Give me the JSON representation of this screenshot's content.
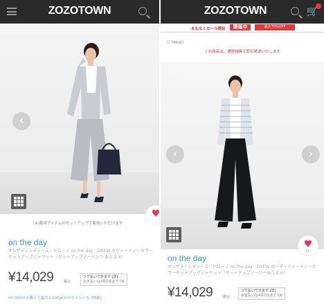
{
  "left": {
    "logo": "ZOZOTOWN",
    "caption": "[※]着用アイテムのセットアップで着用いただけます",
    "brand": "on the day",
    "product_name": "オンザディレディース：ドローノ on the day：DREW きツィードノーカラーセットアップジャケット（セットアップアーバンツ おりまメ）",
    "price": "¥14,029",
    "tax": "税込",
    "stock_line1": "ツケ払いできます [詳]",
    "stock_line2": "お支払いは4月1日まで OK",
    "promo": "¥5,000以上購入で最大1,000pt分のポイントも [詳細]"
  },
  "right": {
    "logo": "ZOZOTOWN",
    "sale_text": "まもなくセール開始",
    "sale_badge": "開催中",
    "sale_sub": "最大70%OFF",
    "breadcrumb": "三 TAKAO",
    "notice": "この商品は、通常価格で即日発送いたします",
    "brand": "on the day",
    "product_name": "オンザディレディース：ドローノ on the day：DREW ボーダーツィードノーカラーセットアップジャケット（セットアップノースーおりまメ）",
    "price": "¥14,029",
    "tax": "税込",
    "stock_line1": "ツケ払いできます [詳]",
    "stock_line2": "お支払いは4月1日まで OK",
    "heart_count": "72"
  },
  "icons": {
    "menu": "menu-icon",
    "search": "search-icon",
    "cart": "cart-icon",
    "prev": "chevron-left-icon",
    "next": "chevron-right-icon",
    "grid": "grid-icon",
    "heart": "heart-icon"
  },
  "colors": {
    "header": "#2a2a2a",
    "accent_blue": "#3a9bd8",
    "sale_red": "#e9363d"
  }
}
